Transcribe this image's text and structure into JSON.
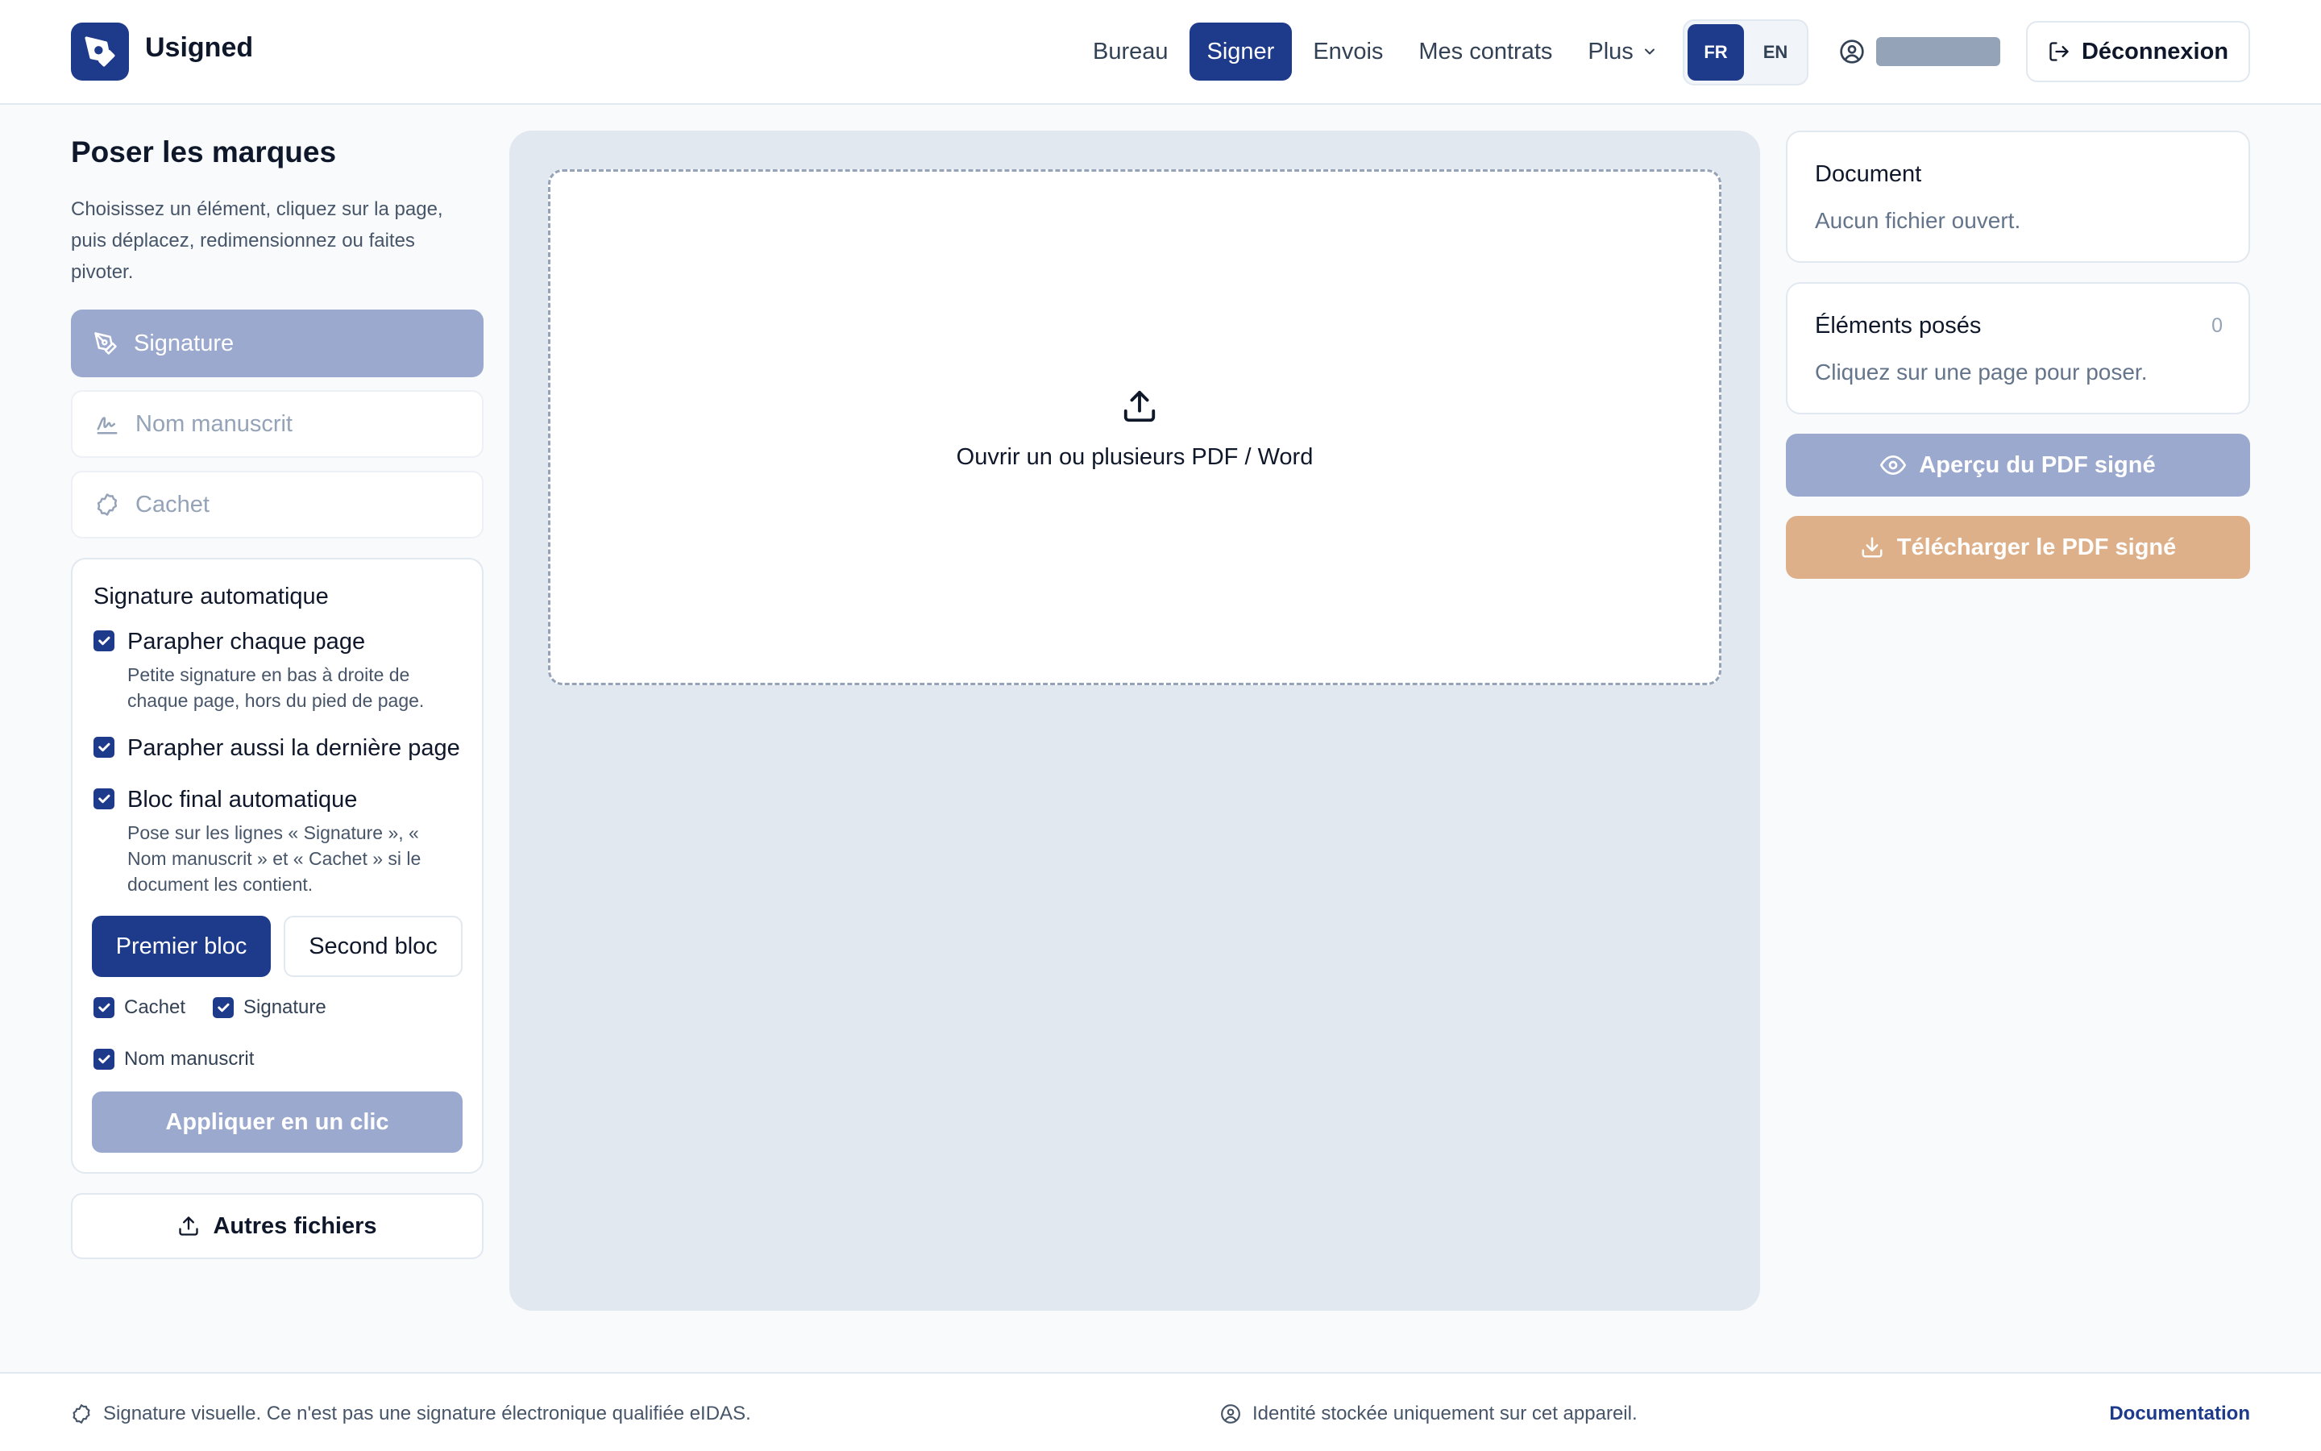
{
  "app": {
    "name": "Usigned"
  },
  "nav": {
    "items": [
      {
        "label": "Bureau",
        "active": false
      },
      {
        "label": "Signer",
        "active": true
      },
      {
        "label": "Envois",
        "active": false
      },
      {
        "label": "Mes contrats",
        "active": false
      }
    ],
    "more_label": "Plus"
  },
  "lang": {
    "fr": "FR",
    "en": "EN",
    "active": "FR"
  },
  "user": {
    "logout_label": "Déconnexion"
  },
  "left": {
    "title": "Poser les marques",
    "description": "Choisissez un élément, cliquez sur la page, puis déplacez, redimensionnez ou faites pivoter.",
    "tools": [
      {
        "label": "Signature",
        "icon": "pen-icon",
        "active": true
      },
      {
        "label": "Nom manuscrit",
        "icon": "signature-icon",
        "active": false
      },
      {
        "label": "Cachet",
        "icon": "stamp-icon",
        "active": false
      }
    ],
    "auto": {
      "title": "Signature automatique",
      "options": [
        {
          "label": "Parapher chaque page",
          "checked": true,
          "description": "Petite signature en bas à droite de chaque page, hors du pied de page."
        },
        {
          "label": "Parapher aussi la dernière page",
          "checked": true,
          "description": ""
        },
        {
          "label": "Bloc final automatique",
          "checked": true,
          "description": "Pose sur les lignes « Signature », « Nom manuscrit » et « Cachet » si le document les contient."
        }
      ],
      "bloc_first": "Premier bloc",
      "bloc_second": "Second bloc",
      "active_bloc": "Premier bloc",
      "elements": [
        {
          "label": "Cachet",
          "checked": true
        },
        {
          "label": "Signature",
          "checked": true
        },
        {
          "label": "Nom manuscrit",
          "checked": true
        }
      ],
      "apply_label": "Appliquer en un clic"
    },
    "other_files_label": "Autres fichiers"
  },
  "canvas": {
    "dropzone_label": "Ouvrir un ou plusieurs PDF / Word"
  },
  "right": {
    "document": {
      "title": "Document",
      "status": "Aucun fichier ouvert."
    },
    "elements": {
      "title": "Éléments posés",
      "count": "0",
      "hint": "Cliquez sur une page pour poser."
    },
    "preview_label": "Aperçu du PDF signé",
    "download_label": "Télécharger le PDF signé"
  },
  "footer": {
    "notice": "Signature visuelle. Ce n'est pas une signature électronique qualifiée eIDAS.",
    "identity": "Identité stockée uniquement sur cet appareil.",
    "docs_label": "Documentation"
  },
  "colors": {
    "primary": "#1e3a8a",
    "primary_disabled": "#9ca9ce",
    "download_disabled": "#ddb08a",
    "canvas_bg": "#e2e8f0"
  }
}
